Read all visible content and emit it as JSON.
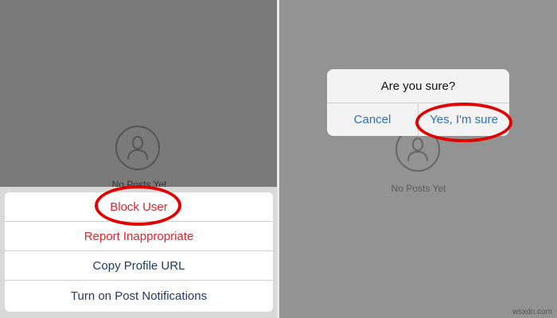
{
  "left": {
    "empty_state": "No Posts Yet",
    "action_sheet": {
      "items": [
        {
          "label": "Block User",
          "style": "danger"
        },
        {
          "label": "Report Inappropriate",
          "style": "danger"
        },
        {
          "label": "Copy Profile URL",
          "style": "default"
        },
        {
          "label": "Turn on Post Notifications",
          "style": "default"
        }
      ]
    }
  },
  "right": {
    "empty_state": "No Posts Yet",
    "alert": {
      "title": "Are you sure?",
      "cancel_label": "Cancel",
      "confirm_label": "Yes, I'm sure"
    }
  },
  "watermark": "wsxdn.com",
  "colors": {
    "danger": "#e2232a",
    "action_text": "#1f3a66",
    "alert_button": "#2e6fc0",
    "highlight": "#e00000"
  },
  "icons": [
    "profile-placeholder-icon"
  ]
}
